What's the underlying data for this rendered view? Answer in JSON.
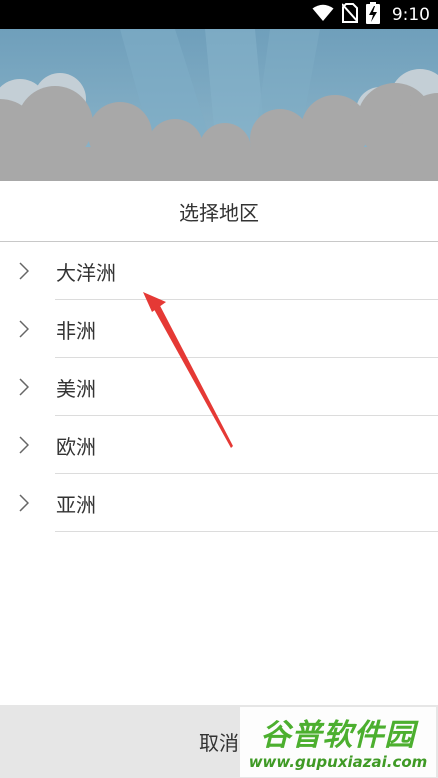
{
  "status_bar": {
    "time": "9:10",
    "icons": [
      "wifi-icon",
      "no-sim-icon",
      "battery-charging-icon"
    ]
  },
  "banner": {
    "description_icon": "cloud-sky-banner"
  },
  "dialog": {
    "title": "选择地区",
    "regions": [
      {
        "label": "大洋洲",
        "icon": "chevron-right-icon"
      },
      {
        "label": "非洲",
        "icon": "chevron-right-icon"
      },
      {
        "label": "美洲",
        "icon": "chevron-right-icon"
      },
      {
        "label": "欧洲",
        "icon": "chevron-right-icon"
      },
      {
        "label": "亚洲",
        "icon": "chevron-right-icon"
      }
    ],
    "cancel_label": "取消"
  },
  "annotation": {
    "arrow_color": "#e53935"
  },
  "watermark": {
    "title": "谷普软件园",
    "url": "www.gupuxiazai.com"
  },
  "colors": {
    "status_bar": "#000000",
    "sky_top": "#6f9fbb",
    "cloud": "#a9a9a9",
    "divider": "#dcdcdc",
    "cancel_bg": "#e6e6e6",
    "watermark_green": "#4caf2f"
  }
}
